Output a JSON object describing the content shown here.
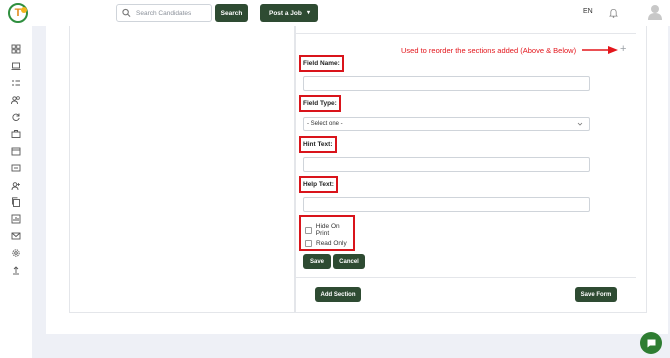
{
  "header": {
    "logo_letter": "T",
    "search": {
      "placeholder": "Search Candidates",
      "button_label": "Search"
    },
    "post_job_label": "Post a Job",
    "language": "EN"
  },
  "sidebar": {
    "items": [
      {
        "icon": "dashboard-icon"
      },
      {
        "icon": "laptop-icon"
      },
      {
        "icon": "task-list-icon"
      },
      {
        "icon": "users-icon"
      },
      {
        "icon": "refresh-icon"
      },
      {
        "icon": "briefcase-icon"
      },
      {
        "icon": "calendar-icon"
      },
      {
        "icon": "message-icon"
      },
      {
        "icon": "user-add-icon"
      },
      {
        "icon": "copy-icon"
      },
      {
        "icon": "report-icon"
      },
      {
        "icon": "mail-icon"
      },
      {
        "icon": "settings-icon"
      },
      {
        "icon": "upload-icon"
      }
    ]
  },
  "form": {
    "annotation": "Used to reorder the sections added (Above & Below)",
    "field_name_label": "Field Name:",
    "field_type_label": "Field Type:",
    "field_type_value": "- Select one -",
    "hint_text_label": "Hint Text:",
    "help_text_label": "Help Text:",
    "hide_on_print_label": "Hide On Print",
    "read_only_label": "Read Only",
    "save_label": "Save",
    "cancel_label": "Cancel",
    "add_section_label": "Add Section",
    "save_form_label": "Save Form"
  },
  "colors": {
    "primary_button": "#2e4b32",
    "annotation_red": "#e3161c",
    "chat_green": "#2e7d32"
  }
}
